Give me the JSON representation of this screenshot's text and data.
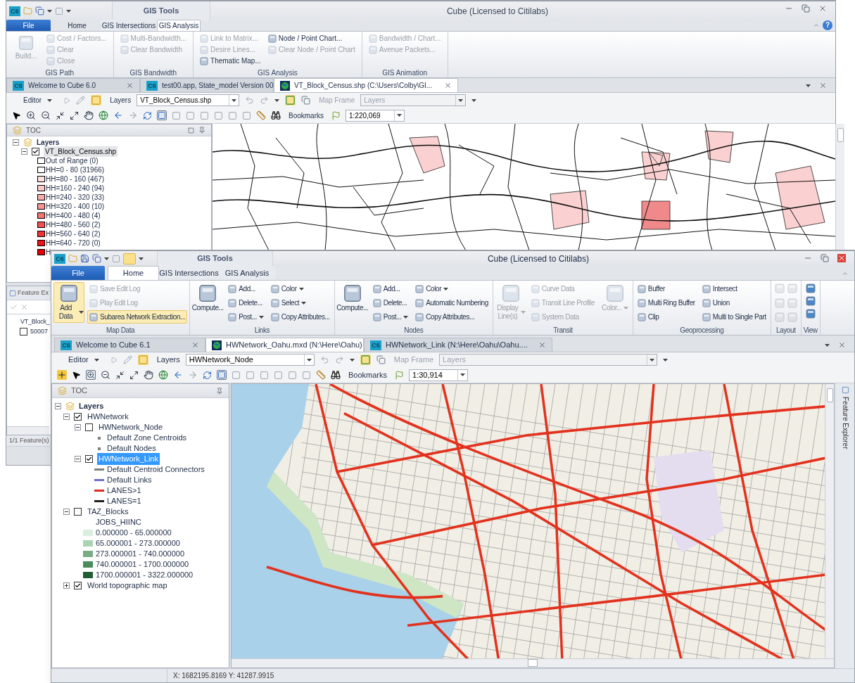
{
  "back_window": {
    "active": false,
    "logo": "C6",
    "title": "Cube (Licensed to Citilabs)",
    "contextual_header": "GIS Tools",
    "help": "?",
    "ribbon_tabs": [
      {
        "label": "File",
        "kind": "file",
        "selected": false
      },
      {
        "label": "Home",
        "kind": "tab",
        "selected": false
      },
      {
        "label": "GIS Intersections",
        "kind": "context",
        "selected": false
      },
      {
        "label": "GIS Analysis",
        "kind": "context",
        "selected": true
      }
    ],
    "ribbon_groups": [
      {
        "label": "GIS Path",
        "kind": "buttons",
        "columns": [
          [
            {
              "label": "Build...",
              "kind": "large",
              "disabled": true,
              "highlighted": false,
              "dropdown": false
            }
          ],
          [
            {
              "label": "Cost / Factors...",
              "kind": "small",
              "disabled": true,
              "highlighted": false,
              "dropdown": false
            },
            {
              "label": "Clear",
              "kind": "small",
              "disabled": true,
              "highlighted": false,
              "dropdown": false
            },
            {
              "label": "Close",
              "kind": "small",
              "disabled": true,
              "highlighted": false,
              "dropdown": false
            }
          ]
        ]
      },
      {
        "label": "GIS Bandwidth",
        "kind": "buttons",
        "columns": [
          [
            {
              "label": "Multi-Bandwidth...",
              "kind": "small",
              "disabled": true,
              "highlighted": false,
              "dropdown": false
            },
            {
              "label": "Clear Bandwidth",
              "kind": "small",
              "disabled": true,
              "highlighted": false,
              "dropdown": false
            }
          ]
        ]
      },
      {
        "label": "GIS Analysis",
        "kind": "buttons",
        "columns": [
          [
            {
              "label": "Link to Matrix...",
              "kind": "small",
              "disabled": true,
              "highlighted": false,
              "dropdown": false
            },
            {
              "label": "Desire Lines...",
              "kind": "small",
              "disabled": true,
              "highlighted": false,
              "dropdown": false
            },
            {
              "label": "Thematic Map...",
              "kind": "small",
              "disabled": false,
              "highlighted": false,
              "dropdown": false
            }
          ],
          [
            {
              "label": "Node / Point Chart...",
              "kind": "small",
              "disabled": false,
              "highlighted": false,
              "dropdown": false
            },
            {
              "label": "Clear Node / Point Chart",
              "kind": "small",
              "disabled": true,
              "highlighted": false,
              "dropdown": false
            }
          ]
        ]
      },
      {
        "label": "GIS Animation",
        "kind": "buttons",
        "columns": [
          [
            {
              "label": "Bandwidth / Chart...",
              "kind": "small",
              "disabled": true,
              "highlighted": false,
              "dropdown": false
            },
            {
              "label": "Avenue Packets...",
              "kind": "small",
              "disabled": true,
              "highlighted": false,
              "dropdown": false
            }
          ]
        ]
      }
    ],
    "document_tabs": [
      {
        "label": "Welcome to Cube 6.0",
        "kind": "cube",
        "icon_text": "C6",
        "selected": false
      },
      {
        "label": "test00.app, State_model Version 00",
        "kind": "cube",
        "icon_text": "C6",
        "selected": false
      },
      {
        "label": "VT_Block_Census.shp (C:\\Users\\Colby\\GI...",
        "kind": "map",
        "selected": true
      }
    ],
    "toolbar": {
      "editor": "Editor",
      "layers_label": "Layers",
      "layers_value": "VT_Block_Census.shp",
      "map_frame_label": "Map Frame",
      "map_frame_value": "Layers",
      "bookmarks": "Bookmarks",
      "scale": "1:220,069"
    },
    "toc": {
      "title": "TOC",
      "root": {
        "label": "Layers",
        "expanded": true,
        "layers": [
          {
            "label": "VT_Block_Census.shp",
            "checked": true,
            "expanded": true,
            "selected": true,
            "legend": [
              {
                "kind": "swatch",
                "label": "Out of Range (0)",
                "color": "#ffffff"
              },
              {
                "kind": "swatch",
                "label": "HH=0 - 80 (31966)",
                "color": "#ffffff"
              },
              {
                "kind": "swatch",
                "label": "HH=80 - 160 (467)",
                "color": "#fde2e2"
              },
              {
                "kind": "swatch",
                "label": "HH=160 - 240 (94)",
                "color": "#fbc9c9"
              },
              {
                "kind": "swatch",
                "label": "HH=240 - 320 (33)",
                "color": "#f9abab"
              },
              {
                "kind": "swatch",
                "label": "HH=320 - 400 (10)",
                "color": "#f79393"
              },
              {
                "kind": "swatch",
                "label": "HH=400 - 480 (4)",
                "color": "#f47373"
              },
              {
                "kind": "swatch",
                "label": "HH=480 - 560 (2)",
                "color": "#f25050"
              },
              {
                "kind": "swatch",
                "label": "HH=560 - 640 (2)",
                "color": "#f03333"
              },
              {
                "kind": "swatch",
                "label": "HH=640 - 720 (0)",
                "color": "#ee1414"
              },
              {
                "kind": "swatch",
                "label": "H",
                "color": "#e00000"
              }
            ]
          }
        ]
      }
    },
    "feature_explorer": {
      "title": "Feature Ex",
      "parent": "VT_Block_",
      "item": {
        "label": "50007",
        "checked": false
      },
      "status": "1/1 Feature(s)"
    }
  },
  "front_window": {
    "active": true,
    "logo": "C6",
    "title": "Cube (Licensed to Citilabs)",
    "contextual_header": "GIS Tools",
    "ribbon_tabs": [
      {
        "label": "File",
        "kind": "file",
        "selected": false
      },
      {
        "label": "Home",
        "kind": "tab",
        "selected": true
      },
      {
        "label": "GIS Intersections",
        "kind": "context",
        "selected": false
      },
      {
        "label": "GIS Analysis",
        "kind": "context",
        "selected": false
      }
    ],
    "ribbon_groups": [
      {
        "label": "Map Data",
        "kind": "buttons",
        "columns": [
          [
            {
              "label": "Add Data",
              "kind": "large",
              "disabled": false,
              "highlighted": true,
              "dropdown": true
            }
          ],
          [
            {
              "label": "Save Edit Log",
              "kind": "small",
              "disabled": true,
              "highlighted": false,
              "dropdown": false
            },
            {
              "label": "Play Edit Log",
              "kind": "small",
              "disabled": true,
              "highlighted": false,
              "dropdown": false
            },
            {
              "label": "Subarea Network Extraction...",
              "kind": "small",
              "disabled": false,
              "highlighted": true,
              "dropdown": false
            }
          ]
        ]
      },
      {
        "label": "Links",
        "kind": "buttons",
        "columns": [
          [
            {
              "label": "Compute...",
              "kind": "large",
              "disabled": false,
              "highlighted": false,
              "dropdown": false
            }
          ],
          [
            {
              "label": "Add...",
              "kind": "small",
              "disabled": false,
              "highlighted": false,
              "dropdown": false
            },
            {
              "label": "Delete...",
              "kind": "small",
              "disabled": false,
              "highlighted": false,
              "dropdown": false
            },
            {
              "label": "Post...",
              "kind": "small",
              "disabled": false,
              "highlighted": false,
              "dropdown": true
            }
          ],
          [
            {
              "label": "Color",
              "kind": "small",
              "disabled": false,
              "highlighted": false,
              "dropdown": true
            },
            {
              "label": "Select",
              "kind": "small",
              "disabled": false,
              "highlighted": false,
              "dropdown": true
            },
            {
              "label": "Copy Attributes...",
              "kind": "small",
              "disabled": false,
              "highlighted": false,
              "dropdown": false
            }
          ]
        ]
      },
      {
        "label": "Nodes",
        "kind": "buttons",
        "columns": [
          [
            {
              "label": "Compute...",
              "kind": "large",
              "disabled": false,
              "highlighted": false,
              "dropdown": false
            }
          ],
          [
            {
              "label": "Add...",
              "kind": "small",
              "disabled": false,
              "highlighted": false,
              "dropdown": false
            },
            {
              "label": "Delete...",
              "kind": "small",
              "disabled": false,
              "highlighted": false,
              "dropdown": false
            },
            {
              "label": "Post...",
              "kind": "small",
              "disabled": false,
              "highlighted": false,
              "dropdown": true
            }
          ],
          [
            {
              "label": "Color",
              "kind": "small",
              "disabled": false,
              "highlighted": false,
              "dropdown": true
            },
            {
              "label": "Automatic Numbering",
              "kind": "small",
              "disabled": false,
              "highlighted": false,
              "dropdown": false
            },
            {
              "label": "Copy Attributes...",
              "kind": "small",
              "disabled": false,
              "highlighted": false,
              "dropdown": false
            }
          ]
        ]
      },
      {
        "label": "Transit",
        "kind": "buttons",
        "columns": [
          [
            {
              "label": "Display Line(s)",
              "kind": "large",
              "disabled": true,
              "highlighted": false,
              "dropdown": true
            }
          ],
          [
            {
              "label": "Curve Data",
              "kind": "small",
              "disabled": true,
              "highlighted": false,
              "dropdown": false
            },
            {
              "label": "Transit Line Profile",
              "kind": "small",
              "disabled": true,
              "highlighted": false,
              "dropdown": false
            },
            {
              "label": "System Data",
              "kind": "small",
              "disabled": true,
              "highlighted": false,
              "dropdown": false
            }
          ],
          [
            {
              "label": "Color...",
              "kind": "large",
              "disabled": true,
              "highlighted": false,
              "dropdown": true
            }
          ]
        ]
      },
      {
        "label": "Geoprocessing",
        "kind": "buttons",
        "columns": [
          [
            {
              "label": "Buffer",
              "kind": "small",
              "disabled": false,
              "highlighted": false,
              "dropdown": false
            },
            {
              "label": "Multi Ring Buffer",
              "kind": "small",
              "disabled": false,
              "highlighted": false,
              "dropdown": false
            },
            {
              "label": "Clip",
              "kind": "small",
              "disabled": false,
              "highlighted": false,
              "dropdown": false
            }
          ],
          [
            {
              "label": "Intersect",
              "kind": "small",
              "disabled": false,
              "highlighted": false,
              "dropdown": false
            },
            {
              "label": "Union",
              "kind": "small",
              "disabled": false,
              "highlighted": false,
              "dropdown": false
            },
            {
              "label": "Multi to Single Part",
              "kind": "small",
              "disabled": false,
              "highlighted": false,
              "dropdown": false
            }
          ]
        ]
      },
      {
        "label": "Layout",
        "kind": "icon_grid"
      },
      {
        "label": "View",
        "kind": "icon_column"
      }
    ],
    "document_tabs": [
      {
        "label": "Welcome to Cube 6.1",
        "kind": "cube",
        "icon_text": "C6",
        "selected": false
      },
      {
        "label": "HWNetwork_Oahu.mxd (N:\\Here\\Oahu)",
        "kind": "map",
        "selected": true
      },
      {
        "label": "HWNetwork_Link (N:\\Here\\Oahu\\Oahu....",
        "kind": "cube",
        "icon_text": "C6",
        "selected": false
      }
    ],
    "toolbar": {
      "editor": "Editor",
      "layers_label": "Layers",
      "layers_value": "HWNetwork_Node",
      "map_frame_label": "Map Frame",
      "map_frame_value": "Layers",
      "bookmarks": "Bookmarks",
      "scale": "1:30,914"
    },
    "toc": {
      "title": "TOC",
      "root": {
        "label": "Layers",
        "expanded": true,
        "layers": [
          {
            "label": "HWNetwork",
            "checked": true,
            "expanded": true,
            "selected": false,
            "layers": [
              {
                "label": "HWNetwork_Node",
                "checked": false,
                "expanded": true,
                "selected": false,
                "legend": [
                  {
                    "kind": "point",
                    "label": "Default Zone Centroids",
                    "color": "#808080"
                  },
                  {
                    "kind": "point",
                    "label": "Default Nodes",
                    "color": "#808080"
                  }
                ]
              },
              {
                "label": "HWNetwork_Link",
                "checked": true,
                "expanded": true,
                "selected": true,
                "legend": [
                  {
                    "kind": "line",
                    "label": "Default Centroid Connectors",
                    "color": "#808080"
                  },
                  {
                    "kind": "line",
                    "label": "Default Links",
                    "color": "#7070cc"
                  },
                  {
                    "kind": "line",
                    "label": "LANES>1",
                    "color": "#e02a1a"
                  },
                  {
                    "kind": "line",
                    "label": "LANES=1",
                    "color": "#202020"
                  }
                ]
              }
            ]
          },
          {
            "label": "TAZ_Blocks",
            "checked": false,
            "expanded": true,
            "selected": false,
            "legend": [
              {
                "kind": "heading",
                "label": "JOBS_HIINC"
              },
              {
                "kind": "swatch",
                "label": "0.000000 - 65.000000",
                "color": "#d9eedf"
              },
              {
                "kind": "swatch",
                "label": "65.000001 - 273.000000",
                "color": "#a9d3b2"
              },
              {
                "kind": "swatch",
                "label": "273.000001 - 740.000000",
                "color": "#78ad86"
              },
              {
                "kind": "swatch",
                "label": "740.000001 - 1700.000000",
                "color": "#4b8a5b"
              },
              {
                "kind": "swatch",
                "label": "1700.000001 - 3322.000000",
                "color": "#215e33"
              }
            ]
          },
          {
            "label": "World topographic map",
            "checked": true,
            "expanded": false,
            "selected": false
          }
        ]
      }
    },
    "side_panel": "Feature Explorer",
    "status_bar": {
      "coordinates": "X: 1682195.8169 Y: 41287.9915"
    }
  }
}
